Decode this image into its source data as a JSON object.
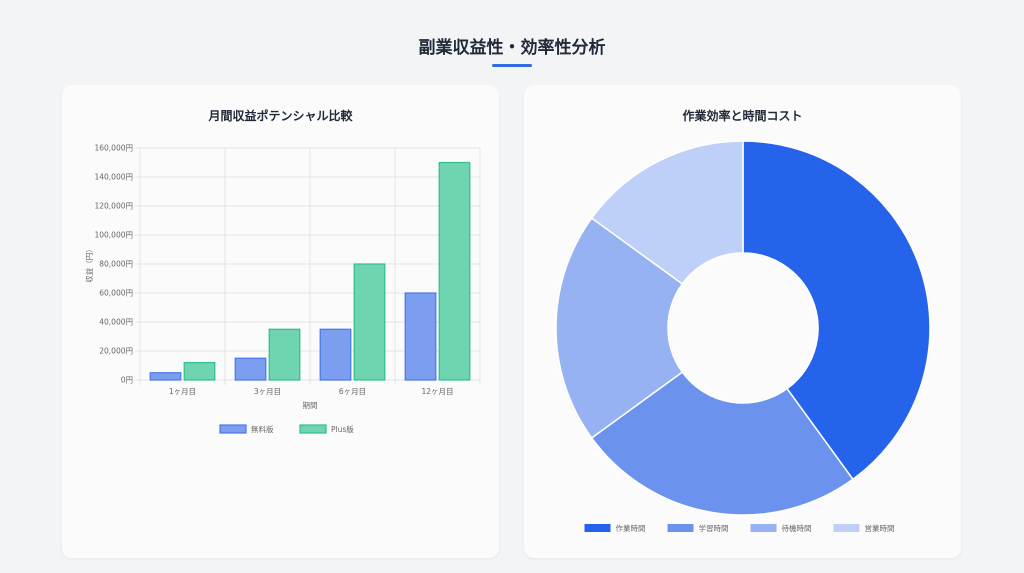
{
  "page": {
    "title": "副業収益性・効率性分析",
    "accent_color": "#2f6be4"
  },
  "chart_data": [
    {
      "type": "bar",
      "title": "月間収益ポテンシャル比較",
      "categories": [
        "1ヶ月目",
        "3ヶ月目",
        "6ヶ月目",
        "12ヶ月目"
      ],
      "series": [
        {
          "name": "無料版",
          "values": [
            5000,
            15000,
            35000,
            60000
          ],
          "color": "#7b9ef0",
          "border": "#4a76e6"
        },
        {
          "name": "Plus版",
          "values": [
            12000,
            35000,
            80000,
            150000
          ],
          "color": "#6fd4b0",
          "border": "#2fbf8a"
        }
      ],
      "ylim": [
        0,
        160000
      ],
      "yticks": [
        "0円",
        "20,000円",
        "40,000円",
        "60,000円",
        "80,000円",
        "100,000円",
        "120,000円",
        "140,000円",
        "160,000円"
      ],
      "xlabel": "期間",
      "ylabel": "収益（円）",
      "grid": true,
      "legend": "bottom"
    },
    {
      "type": "pie",
      "title": "作業効率と時間コスト",
      "labels": [
        "作業時間",
        "学習時間",
        "待機時間",
        "営業時間"
      ],
      "values": [
        40,
        25,
        20,
        15
      ],
      "colors": [
        "#2563eb",
        "#6b93ee",
        "#97b2f2",
        "#bfd0f8"
      ],
      "donut": true,
      "legend": "bottom"
    }
  ]
}
